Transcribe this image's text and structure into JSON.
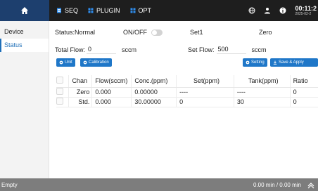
{
  "topbar": {
    "nav": [
      {
        "label": "SEQ",
        "icon": "seq-icon"
      },
      {
        "label": "PLUGIN",
        "icon": "plugin-icon"
      },
      {
        "label": "OPT",
        "icon": "opt-icon"
      }
    ],
    "clock_time": "00:11:2",
    "clock_date": "2025-02-2"
  },
  "sidebar": {
    "items": [
      {
        "label": "Device"
      },
      {
        "label": "Status"
      }
    ]
  },
  "status": {
    "status_text": "Status:Normal",
    "onoff_label": "ON/OFF",
    "set_label": "Set1",
    "zero_label": "Zero",
    "total_flow_label": "Total Flow:",
    "total_flow_value": "0",
    "total_flow_unit": "sccm",
    "set_flow_label": "Set Flow:",
    "set_flow_value": "500",
    "set_flow_unit": "sccm"
  },
  "buttons": {
    "unit": "Unit",
    "calibration": "Calibration",
    "setting": "Setting",
    "save_apply": "Save & Apply"
  },
  "table": {
    "headers": [
      "Chan",
      "Flow(sccm)",
      "Conc.(ppm)",
      "Set(ppm)",
      "Tank(ppm)",
      "Ratio"
    ],
    "rows": [
      [
        "Zero",
        "0.000",
        "0.00000",
        "----",
        "----",
        "0"
      ],
      [
        "Std.",
        "0.000",
        "30.00000",
        "0",
        "30",
        "0"
      ]
    ]
  },
  "bottom": {
    "left_text": "Empty",
    "time_text": "0.00 min / 0.00 min"
  },
  "colors": {
    "accent": "#1f77c8",
    "topbar": "#1e1e1e",
    "home": "#1d3f6e"
  }
}
